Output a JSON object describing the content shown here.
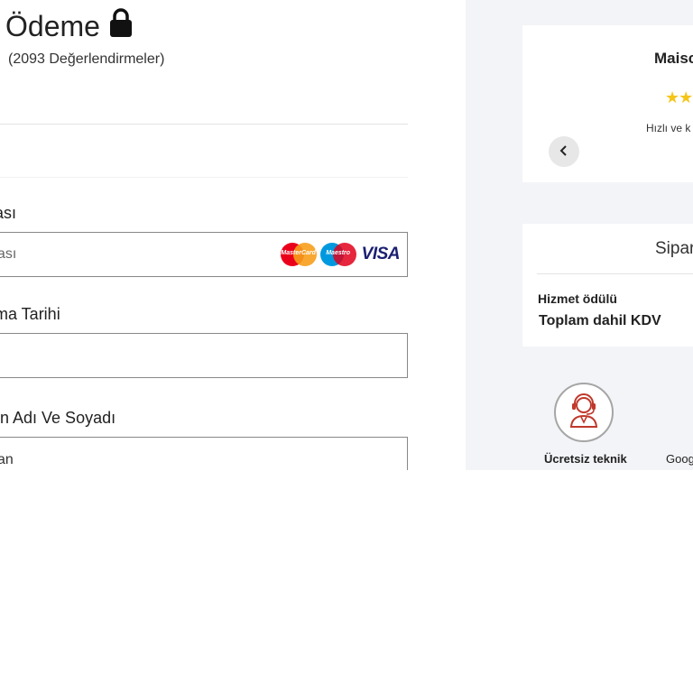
{
  "page": {
    "title": "i Ödeme",
    "rating_count": "(2093 Değerlendirmeler)"
  },
  "form": {
    "card_number": {
      "label": "ası",
      "placeholder": "ası",
      "logos": {
        "mastercard": "MasterCard",
        "maestro": "Maestro",
        "visa": "VISA"
      }
    },
    "expiry": {
      "label": "ma Tarihi",
      "value": ""
    },
    "holder": {
      "label": "in Adı Ve Soyadı",
      "value": "an"
    }
  },
  "review_carousel": {
    "name": "Maisc",
    "stars": "★★",
    "snippet": "Hızlı ve k",
    "prev_icon": "chevron-left-icon"
  },
  "order_summary": {
    "title": "Sipar",
    "service_fee_label": "Hizmet ödülü",
    "total_label": "Toplam dahil KDV"
  },
  "badges": [
    {
      "icon": "headset-support-icon",
      "label": "Ücretsiz teknik"
    },
    {
      "icon": "",
      "label": "Goog"
    }
  ],
  "colors": {
    "accent_red": "#c0392b",
    "star_yellow": "#f5c518",
    "panel_bg": "#f3f4f7",
    "mastercard_red": "#eb001b",
    "mastercard_orange": "#f79e1b",
    "maestro_blue": "#0099df",
    "visa_blue": "#1a1f71"
  }
}
